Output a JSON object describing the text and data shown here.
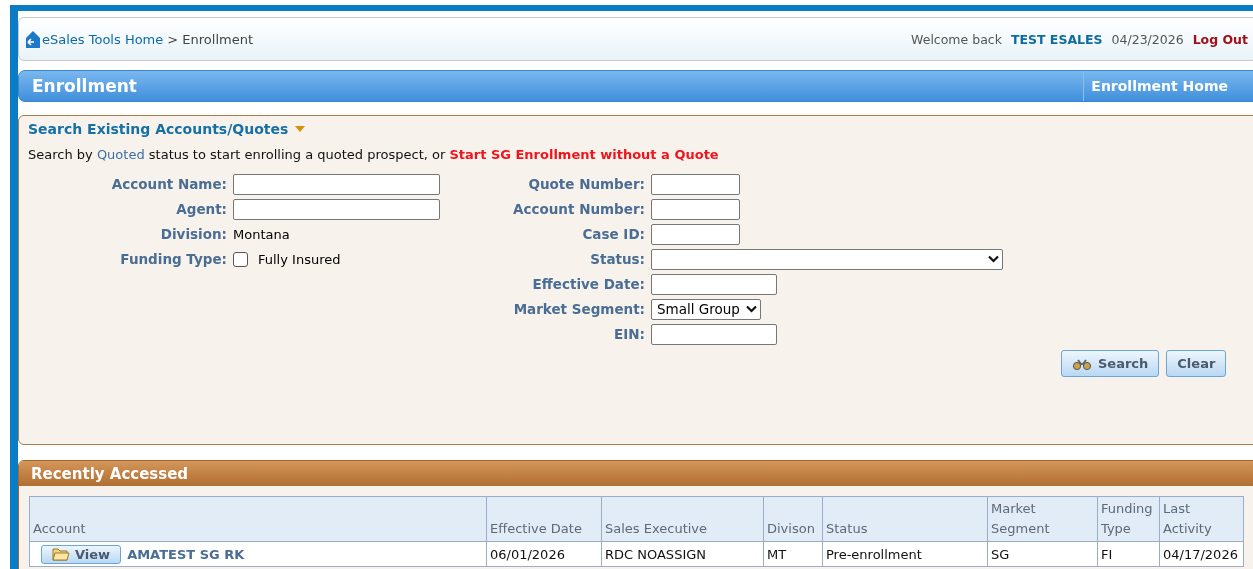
{
  "breadcrumb": {
    "home": "eSales Tools Home",
    "trail": "> Enrollment"
  },
  "user": {
    "welcome": "Welcome back",
    "name": "TEST ESALES",
    "date": "04/23/2026",
    "logout": "Log Out"
  },
  "title_bar": {
    "title": "Enrollment",
    "link": "Enrollment Home"
  },
  "search": {
    "title": "Search Existing Accounts/Quotes",
    "intro_before": "Search by",
    "intro_status": "Quoted",
    "intro_after": "status to start enrolling a quoted prospect, or",
    "intro_link": "Start SG Enrollment without a Quote",
    "left_fields": [
      {
        "kind": "text",
        "label": "Account Name:"
      },
      {
        "kind": "text",
        "label": "Agent:"
      },
      {
        "kind": "static",
        "label": "Division:",
        "value": "Montana"
      },
      {
        "kind": "checkbox",
        "label": "Funding Type:",
        "option": "Fully Insured",
        "checked": false
      }
    ],
    "right_fields": [
      {
        "kind": "text",
        "label": "Quote Number:"
      },
      {
        "kind": "text",
        "label": "Account Number:"
      },
      {
        "kind": "text",
        "label": "Case ID:"
      },
      {
        "kind": "select",
        "label": "Status:"
      },
      {
        "kind": "text",
        "label": "Effective Date:"
      },
      {
        "kind": "select",
        "label": "Market Segment:",
        "value": "Small Group"
      },
      {
        "kind": "text",
        "label": "EIN:"
      }
    ],
    "buttons": [
      {
        "kind": "search",
        "label": "Search"
      },
      {
        "kind": "clear",
        "label": "Clear"
      }
    ]
  },
  "recent": {
    "title": "Recently Accessed",
    "columns": [
      "Account",
      "Effective Date",
      "Sales Executive",
      "Divison",
      "Status",
      "Market Segment",
      "Funding Type",
      "Last Activity"
    ],
    "rows": [
      {
        "action": "View",
        "cells": [
          "AMATEST SG RK",
          "06/01/2026",
          "RDC NOASSIGN",
          "MT",
          "Pre-enrollment",
          "SG",
          "FI",
          "04/17/2026"
        ]
      }
    ]
  }
}
